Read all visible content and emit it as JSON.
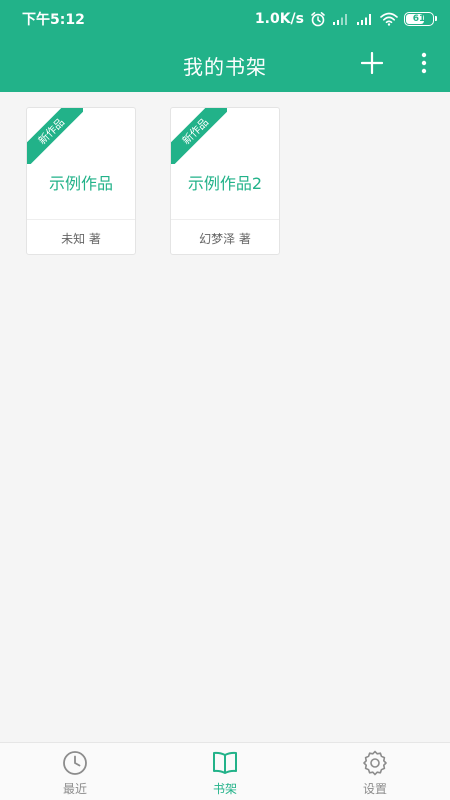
{
  "status_bar": {
    "time": "下午5:12",
    "net_speed": "1.0K/s",
    "battery": "61",
    "icons": [
      "alarm-icon",
      "signal-icon",
      "signal-icon",
      "wifi-icon",
      "battery-icon"
    ]
  },
  "toolbar": {
    "title": "我的书架",
    "add_icon": "plus-icon",
    "more_icon": "more-vertical-icon"
  },
  "books": [
    {
      "badge": "新作品",
      "title": "示例作品",
      "author": "未知 著"
    },
    {
      "badge": "新作品",
      "title": "示例作品2",
      "author": "幻梦泽 著"
    }
  ],
  "bottom_nav": {
    "items": [
      {
        "label": "最近",
        "icon": "clock-icon",
        "active": false
      },
      {
        "label": "书架",
        "icon": "book-icon",
        "active": true
      },
      {
        "label": "设置",
        "icon": "gear-icon",
        "active": false
      }
    ]
  },
  "colors": {
    "accent": "#22b289",
    "background": "#f5f5f5",
    "inactive": "#8c8c8c"
  }
}
